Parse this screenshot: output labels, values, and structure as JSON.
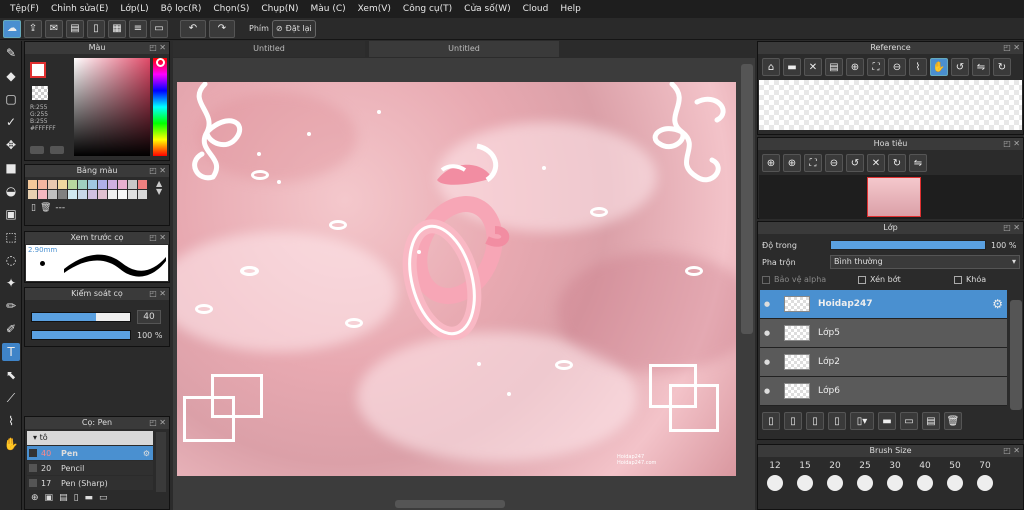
{
  "menu": [
    "Tệp(F)",
    "Chỉnh sửa(E)",
    "Lớp(L)",
    "Bộ lọc(R)",
    "Chọn(S)",
    "Chụp(N)",
    "Màu (C)",
    "Xem(V)",
    "Công cụ(T)",
    "Cửa số(W)",
    "Cloud",
    "Help"
  ],
  "toolbar": {
    "key_label": "Phím",
    "reset_label": "Đặt lại"
  },
  "color_panel": {
    "title": "Màu",
    "r": "R:255",
    "g": "G:255",
    "b": "B:255",
    "hex": "#FFFFFF"
  },
  "palette_panel": {
    "title": "Bảng màu",
    "add_label": "---",
    "colors": [
      "#f4c89a",
      "#f4b6a0",
      "#e8c8b0",
      "#f0d8a0",
      "#b8d8a0",
      "#a0d0c0",
      "#a0c8e0",
      "#b0b0e8",
      "#d0b0e0",
      "#e8b0d0",
      "#c8c8c8",
      "#f08080",
      "#e8d0b0",
      "#f4b8c0",
      "#c0c0c0",
      "#808080",
      "#d0e8f0",
      "#c8d8e8",
      "#d0c0e0",
      "#e0c0d0",
      "#f0f0f0",
      "#f8f8f8",
      "#e0e0e0",
      "#d8d8d8"
    ]
  },
  "brush_preview_panel": {
    "title": "Xem trước cọ",
    "size": "2.90mm"
  },
  "brush_control_panel": {
    "title": "Kiểm soát cọ",
    "size_value": "40",
    "opacity_value": "100 %",
    "size_fraction": 0.65,
    "opacity_fraction": 1.0
  },
  "brush_list_panel": {
    "title": "Cọ: Pen",
    "group": "tô",
    "items": [
      {
        "size": "40",
        "name": "Pen"
      },
      {
        "size": "20",
        "name": "Pencil"
      },
      {
        "size": "17",
        "name": "Pen (Sharp)"
      }
    ]
  },
  "doc_tabs": [
    "Untitled",
    "Untitled"
  ],
  "reference_panel": {
    "title": "Reference"
  },
  "navigator_panel": {
    "title": "Hoa tiêu"
  },
  "layer_panel": {
    "title": "Lớp",
    "opacity_label": "Độ trong",
    "opacity_value": "100 %",
    "blend_label": "Pha trộn",
    "blend_value": "Bình thường",
    "protect_alpha": "Bảo vệ alpha",
    "clip": "Xén bớt",
    "lock": "Khóa",
    "layers": [
      {
        "name": "Hoidap247",
        "selected": true
      },
      {
        "name": "Lớp5",
        "selected": false
      },
      {
        "name": "Lớp2",
        "selected": false
      },
      {
        "name": "Lớp6",
        "selected": false
      }
    ]
  },
  "brush_size_panel": {
    "title": "Brush Size",
    "sizes": [
      "12",
      "15",
      "20",
      "25",
      "30",
      "40",
      "50",
      "70"
    ]
  },
  "canvas": {
    "watermark_line1": "Hoidap247",
    "watermark_line2": "Hoidap247.com"
  }
}
